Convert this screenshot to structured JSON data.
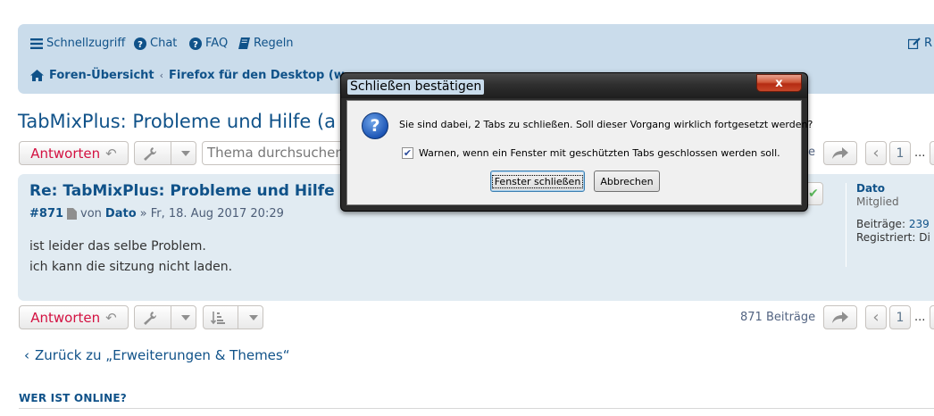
{
  "nav": {
    "quicklinks": "Schnellzugriff",
    "chat": "Chat",
    "faq": "FAQ",
    "rules": "Regeln",
    "right_partial": "R"
  },
  "breadcrumbs": {
    "home": "Foren-Übersicht",
    "forum": "Firefox für den Desktop (w"
  },
  "topic": {
    "title": "TabMixPlus: Probleme und Hilfe (a"
  },
  "toolbar": {
    "reply_label": "Antworten",
    "search_placeholder": "Thema durchsuchen",
    "search_partial_right": "e",
    "page_current": "1",
    "ellipsis": "...",
    "post_count": "871 Beiträge"
  },
  "post": {
    "title": "Re: TabMixPlus: Probleme und Hilfe",
    "number": "#871",
    "by": "von",
    "author": "Dato",
    "date": "» Fr, 18. Aug 2017 20:29",
    "body_line1": "ist leider das selbe Problem.",
    "body_line2": "ich kann die sitzung nicht laden."
  },
  "profile": {
    "name": "Dato",
    "rank": "Mitglied",
    "posts_label": "Beiträge:",
    "posts_value": "239",
    "registered_label": "Registriert:",
    "registered_value": "Di"
  },
  "footer": {
    "back_link": "Zurück zu „Erweiterungen & Themes“",
    "who_online": "WER IST ONLINE?"
  },
  "dialog": {
    "title": "Schließen bestätigen",
    "close_glyph": "x",
    "message": "Sie sind dabei, 2 Tabs zu schließen. Soll dieser Vorgang wirklich fortgesetzt werden?",
    "checkbox_label": "Warnen, wenn ein Fenster mit geschützten Tabs geschlossen werden soll.",
    "checkbox_checked": true,
    "confirm_label": "Fenster schließen",
    "cancel_label": "Abbrechen"
  },
  "colors": {
    "nav_bg": "#cadceb",
    "post_bg": "#e1ebf2",
    "link": "#105289",
    "reply_red": "#d31141"
  }
}
